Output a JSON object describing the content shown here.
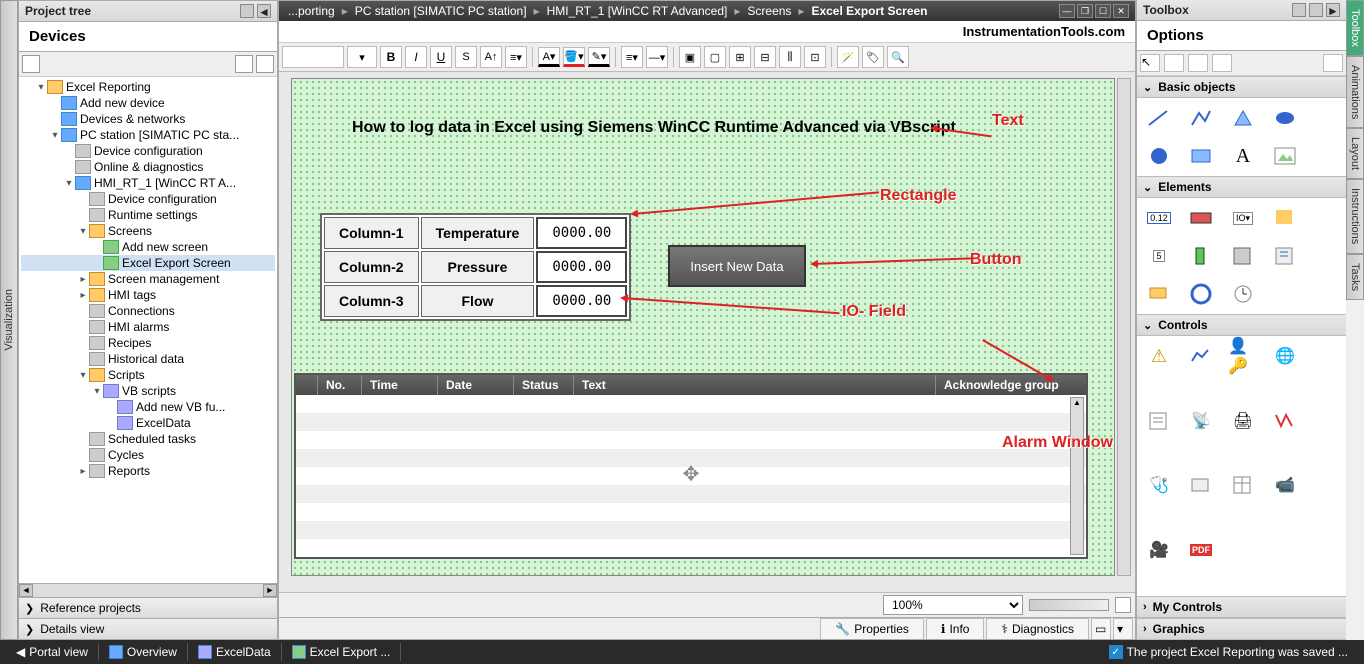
{
  "project_tree": {
    "title": "Project tree",
    "devices_label": "Devices",
    "items": [
      {
        "level": 1,
        "exp": "▾",
        "icon": "folder",
        "label": "Excel Reporting"
      },
      {
        "level": 2,
        "exp": "",
        "icon": "device",
        "label": "Add new device"
      },
      {
        "level": 2,
        "exp": "",
        "icon": "device",
        "label": "Devices & networks"
      },
      {
        "level": 2,
        "exp": "▾",
        "icon": "device",
        "label": "PC station [SIMATIC PC sta..."
      },
      {
        "level": 3,
        "exp": "",
        "icon": "data",
        "label": "Device configuration"
      },
      {
        "level": 3,
        "exp": "",
        "icon": "data",
        "label": "Online & diagnostics"
      },
      {
        "level": 3,
        "exp": "▾",
        "icon": "device",
        "label": "HMI_RT_1 [WinCC RT A..."
      },
      {
        "level": 4,
        "exp": "",
        "icon": "data",
        "label": "Device configuration"
      },
      {
        "level": 4,
        "exp": "",
        "icon": "data",
        "label": "Runtime settings"
      },
      {
        "level": 4,
        "exp": "▾",
        "icon": "folder",
        "label": "Screens"
      },
      {
        "level": 5,
        "exp": "",
        "icon": "screen",
        "label": "Add new screen"
      },
      {
        "level": 5,
        "exp": "",
        "icon": "screen",
        "label": "Excel Export Screen",
        "selected": true
      },
      {
        "level": 4,
        "exp": "▸",
        "icon": "folder",
        "label": "Screen management"
      },
      {
        "level": 4,
        "exp": "▸",
        "icon": "folder",
        "label": "HMI tags"
      },
      {
        "level": 4,
        "exp": "",
        "icon": "data",
        "label": "Connections"
      },
      {
        "level": 4,
        "exp": "",
        "icon": "data",
        "label": "HMI alarms"
      },
      {
        "level": 4,
        "exp": "",
        "icon": "data",
        "label": "Recipes"
      },
      {
        "level": 4,
        "exp": "",
        "icon": "data",
        "label": "Historical data"
      },
      {
        "level": 4,
        "exp": "▾",
        "icon": "folder",
        "label": "Scripts"
      },
      {
        "level": 5,
        "exp": "▾",
        "icon": "script",
        "label": "VB scripts"
      },
      {
        "level": 6,
        "exp": "",
        "icon": "script",
        "label": "Add new VB fu..."
      },
      {
        "level": 6,
        "exp": "",
        "icon": "script",
        "label": "ExcelData"
      },
      {
        "level": 4,
        "exp": "",
        "icon": "data",
        "label": "Scheduled tasks"
      },
      {
        "level": 4,
        "exp": "",
        "icon": "data",
        "label": "Cycles"
      },
      {
        "level": 4,
        "exp": "▸",
        "icon": "data",
        "label": "Reports"
      }
    ],
    "reference_projects": "Reference projects",
    "details_view": "Details view"
  },
  "left_tab": "Visualization",
  "breadcrumb": {
    "parts": [
      "...porting",
      "PC station [SIMATIC PC station]",
      "HMI_RT_1 [WinCC RT Advanced]",
      "Screens",
      "Excel Export Screen"
    ]
  },
  "brand": "InstrumentationTools.com",
  "canvas": {
    "title": "How to log data in Excel using Siemens WinCC Runtime Advanced via VBscript",
    "rows": [
      {
        "col": "Column-1",
        "label": "Temperature",
        "value": "0000.00"
      },
      {
        "col": "Column-2",
        "label": "Pressure",
        "value": "0000.00"
      },
      {
        "col": "Column-3",
        "label": "Flow",
        "value": "0000.00"
      }
    ],
    "button_label": "Insert New Data",
    "alarm_cols": [
      "No.",
      "Time",
      "Date",
      "Status",
      "Text",
      "Acknowledge group"
    ]
  },
  "annotations": {
    "text": "Text",
    "rectangle": "Rectangle",
    "button": "Button",
    "io_field": "IO- Field",
    "alarm_window": "Alarm Window"
  },
  "zoom": "100%",
  "bottom_tabs": {
    "properties": "Properties",
    "info": "Info",
    "diagnostics": "Diagnostics"
  },
  "toolbox": {
    "title": "Toolbox",
    "options": "Options",
    "basic_objects": "Basic objects",
    "elements": "Elements",
    "controls": "Controls",
    "my_controls": "My Controls",
    "graphics": "Graphics"
  },
  "right_tabs": [
    "Toolbox",
    "Animations",
    "Layout",
    "Instructions",
    "Tasks"
  ],
  "status_bar": {
    "portal": "Portal view",
    "overview": "Overview",
    "excel_data": "ExcelData",
    "excel_export": "Excel Export ...",
    "saved_msg": "The project Excel Reporting was saved ..."
  }
}
